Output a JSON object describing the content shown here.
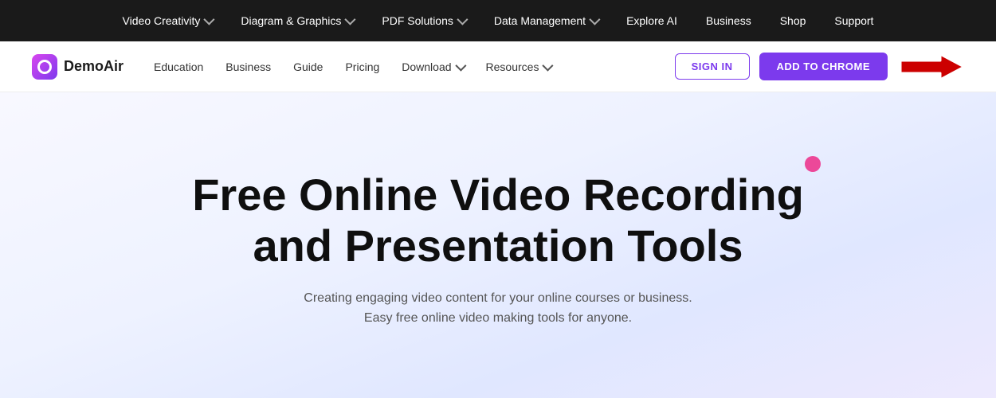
{
  "top_nav": {
    "items": [
      {
        "label": "Video Creativity",
        "has_chevron": true
      },
      {
        "label": "Diagram & Graphics",
        "has_chevron": true
      },
      {
        "label": "PDF Solutions",
        "has_chevron": true
      },
      {
        "label": "Data Management",
        "has_chevron": true
      },
      {
        "label": "Explore AI",
        "has_chevron": false
      },
      {
        "label": "Business",
        "has_chevron": false
      },
      {
        "label": "Shop",
        "has_chevron": false
      },
      {
        "label": "Support",
        "has_chevron": false
      }
    ]
  },
  "sec_nav": {
    "logo_text": "DemoAir",
    "items": [
      {
        "label": "Education",
        "has_chevron": false
      },
      {
        "label": "Business",
        "has_chevron": false
      },
      {
        "label": "Guide",
        "has_chevron": false
      },
      {
        "label": "Pricing",
        "has_chevron": false
      },
      {
        "label": "Download",
        "has_chevron": true
      },
      {
        "label": "Resources",
        "has_chevron": true
      }
    ],
    "sign_in_label": "SIGN IN",
    "add_chrome_label": "ADD TO CHROME"
  },
  "hero": {
    "title": "Free Online Video Recording\nand Presentation Tools",
    "subtitle_line1": "Creating engaging video content for your online courses or business.",
    "subtitle_line2": "Easy free online video making tools for anyone."
  }
}
